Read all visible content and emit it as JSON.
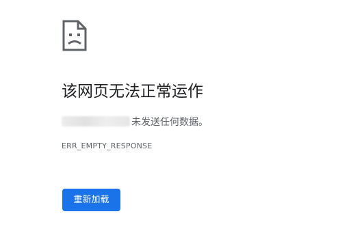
{
  "icon": "sad-page-icon",
  "title": "该网页无法正常运作",
  "message": {
    "text": "未发送任何数据。"
  },
  "error_code": "ERR_EMPTY_RESPONSE",
  "reload_button": {
    "label": "重新加载"
  },
  "colors": {
    "button_background": "#1a73e8",
    "title_text": "#202124",
    "secondary_text": "#5f6368"
  }
}
